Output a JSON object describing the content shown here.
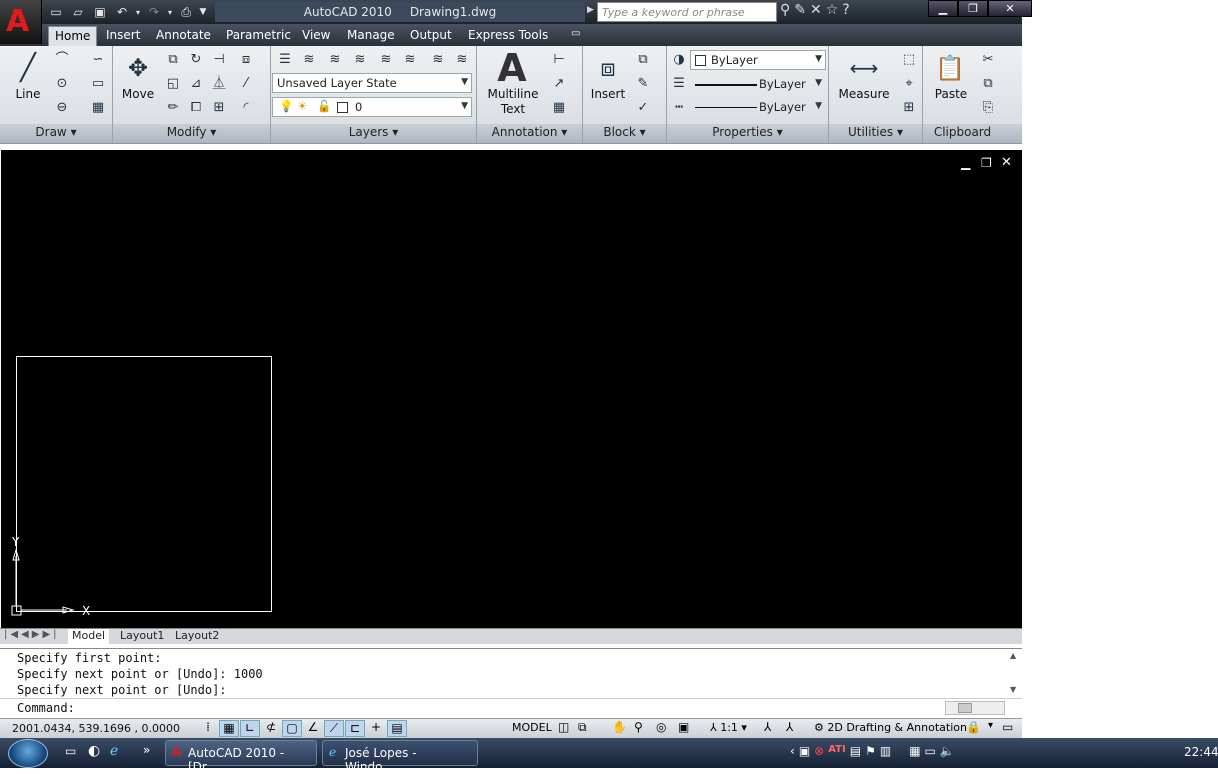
{
  "app": {
    "name": "AutoCAD 2010",
    "file": "Drawing1.dwg"
  },
  "search": {
    "placeholder": "Type a keyword or phrase"
  },
  "tabs": [
    "Home",
    "Insert",
    "Annotate",
    "Parametric",
    "View",
    "Manage",
    "Output",
    "Express Tools"
  ],
  "panels": {
    "draw": {
      "label": "Draw",
      "line": "Line"
    },
    "modify": {
      "label": "Modify",
      "move": "Move"
    },
    "layers": {
      "label": "Layers",
      "layer_state": "Unsaved Layer State",
      "current_layer": "0"
    },
    "annotation": {
      "label": "Annotation",
      "multiline": "Multiline",
      "text": "Text"
    },
    "block": {
      "label": "Block",
      "insert": "Insert"
    },
    "properties": {
      "label": "Properties",
      "color": "ByLayer",
      "linetype": "ByLayer",
      "lineweight": "ByLayer"
    },
    "utilities": {
      "label": "Utilities",
      "measure": "Measure"
    },
    "clipboard": {
      "label": "Clipboard",
      "paste": "Paste"
    }
  },
  "ucs": {
    "x": "X",
    "y": "Y"
  },
  "layout_tabs": [
    "Model",
    "Layout1",
    "Layout2"
  ],
  "command_history": [
    "Specify first point:",
    "Specify next point or [Undo]: 1000",
    "Specify next point or [Undo]:"
  ],
  "command_prompt": "Command:",
  "status": {
    "coords": "2001.0434, 539.1696 , 0.0000",
    "space": "MODEL",
    "scale": "1:1",
    "workspace": "2D Drafting & Annotation"
  },
  "taskbar": {
    "autocad_task": "AutoCAD 2010 - [Dr...",
    "ie_task": "José Lopes - Windo...",
    "clock": "22:44",
    "ati": "ATI"
  },
  "colors": {
    "canvas": "#000000",
    "accent": "#e01b1b",
    "crosshair": "#ffffff"
  }
}
